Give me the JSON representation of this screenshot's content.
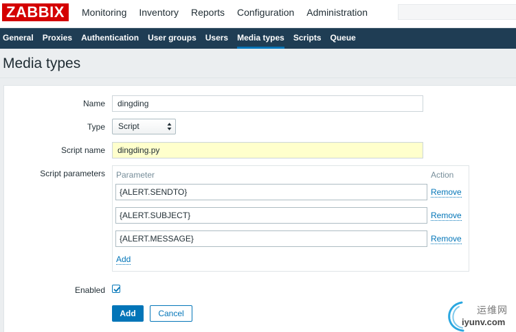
{
  "header": {
    "logo": "ZABBIX",
    "nav": [
      "Monitoring",
      "Inventory",
      "Reports",
      "Configuration",
      "Administration"
    ],
    "active_nav": "Administration"
  },
  "subnav": {
    "items": [
      "General",
      "Proxies",
      "Authentication",
      "User groups",
      "Users",
      "Media types",
      "Scripts",
      "Queue"
    ],
    "active": "Media types"
  },
  "page": {
    "title": "Media types"
  },
  "form": {
    "name_label": "Name",
    "name_value": "dingding",
    "type_label": "Type",
    "type_value": "Script",
    "script_name_label": "Script name",
    "script_name_value": "dingding.py",
    "script_params_label": "Script parameters",
    "params_header": {
      "parameter": "Parameter",
      "action": "Action"
    },
    "params": [
      {
        "value": "{ALERT.SENDTO}",
        "action": "Remove"
      },
      {
        "value": "{ALERT.SUBJECT}",
        "action": "Remove"
      },
      {
        "value": "{ALERT.MESSAGE}",
        "action": "Remove"
      }
    ],
    "params_add": "Add",
    "enabled_label": "Enabled",
    "enabled": true,
    "add_button": "Add",
    "cancel_button": "Cancel"
  },
  "watermark": {
    "text": "运维网",
    "url": "iyunv.com"
  },
  "colors": {
    "brand_red": "#d40000",
    "subnav_bg": "#1f3d54",
    "accent_blue": "#0275b8",
    "highlight_yellow": "#ffffcc"
  }
}
